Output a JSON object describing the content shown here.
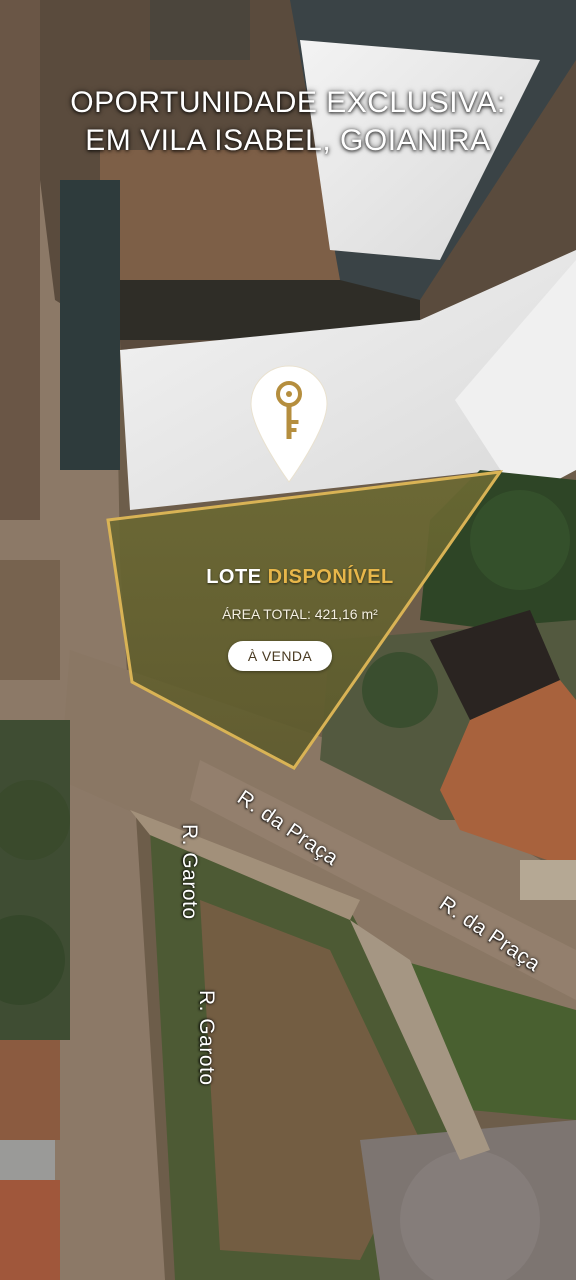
{
  "headline": {
    "line1": "OPORTUNIDADE EXCLUSIVA:",
    "line2": "EM VILA ISABEL, GOIANIRA"
  },
  "lot": {
    "title_word1": "LOTE",
    "title_word2": "DISPONÍVEL",
    "area_text": "ÁREA TOTAL: 421,16 m²",
    "badge": "À VENDA"
  },
  "streets": {
    "label_1": "R. da Praça",
    "label_2": "R. da Praça",
    "label_3": "R. Garoto",
    "label_4": "R. Garoto"
  },
  "icons": {
    "pin": "map-pin-key-icon"
  },
  "colors": {
    "accent_gold": "#c9a24a",
    "title_highlight": "#e7b64a",
    "outline": "#d9b355"
  }
}
